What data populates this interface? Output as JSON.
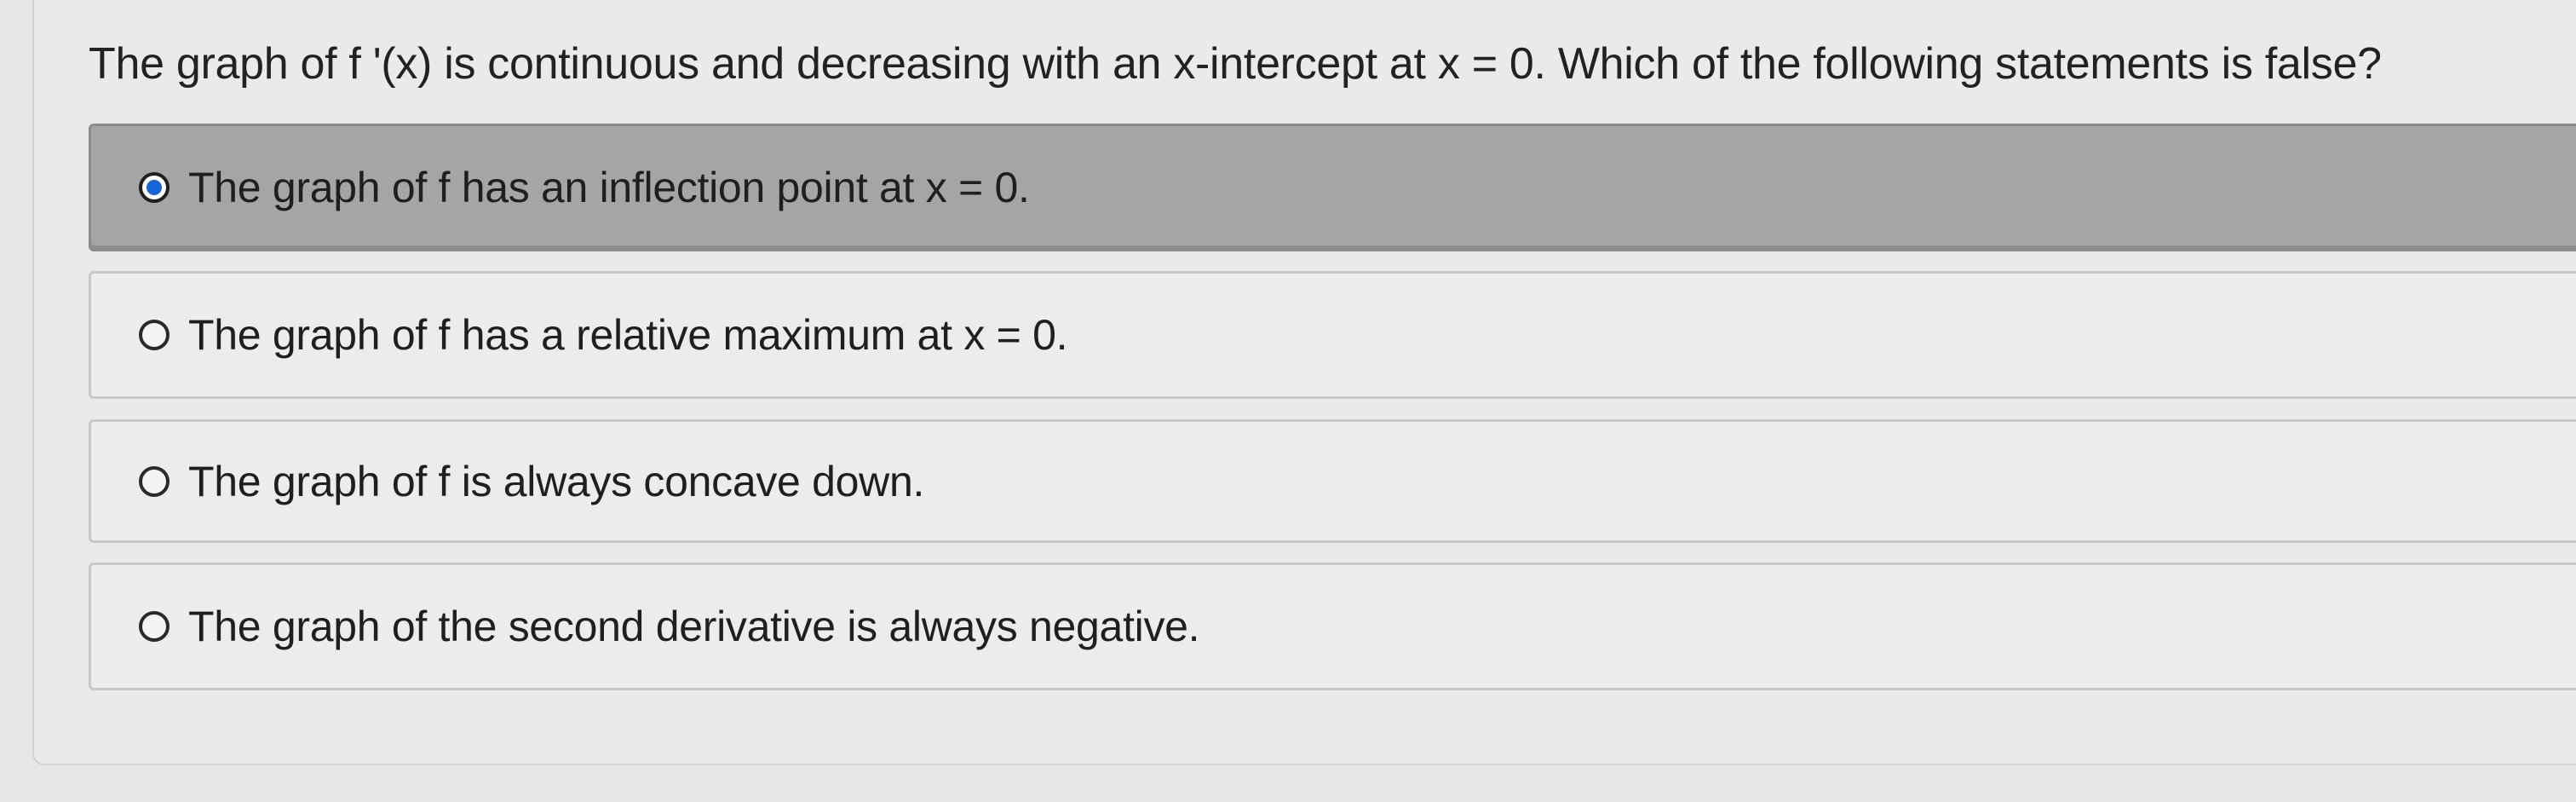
{
  "question": {
    "text": "The graph of f '(x) is continuous and decreasing with an x-intercept at x = 0. Which of the following statements is false?"
  },
  "options": [
    {
      "label": "The graph of f has an inflection point at x = 0.",
      "selected": true
    },
    {
      "label": "The graph of f has a relative maximum at x = 0.",
      "selected": false
    },
    {
      "label": "The graph of f is always concave down.",
      "selected": false
    },
    {
      "label": "The graph of the second derivative is always negative.",
      "selected": false
    }
  ],
  "colors": {
    "selected_radio": "#1565d8",
    "selected_row": "#a5a6a3",
    "row": "#ececea",
    "background": "#e6e7e4"
  }
}
